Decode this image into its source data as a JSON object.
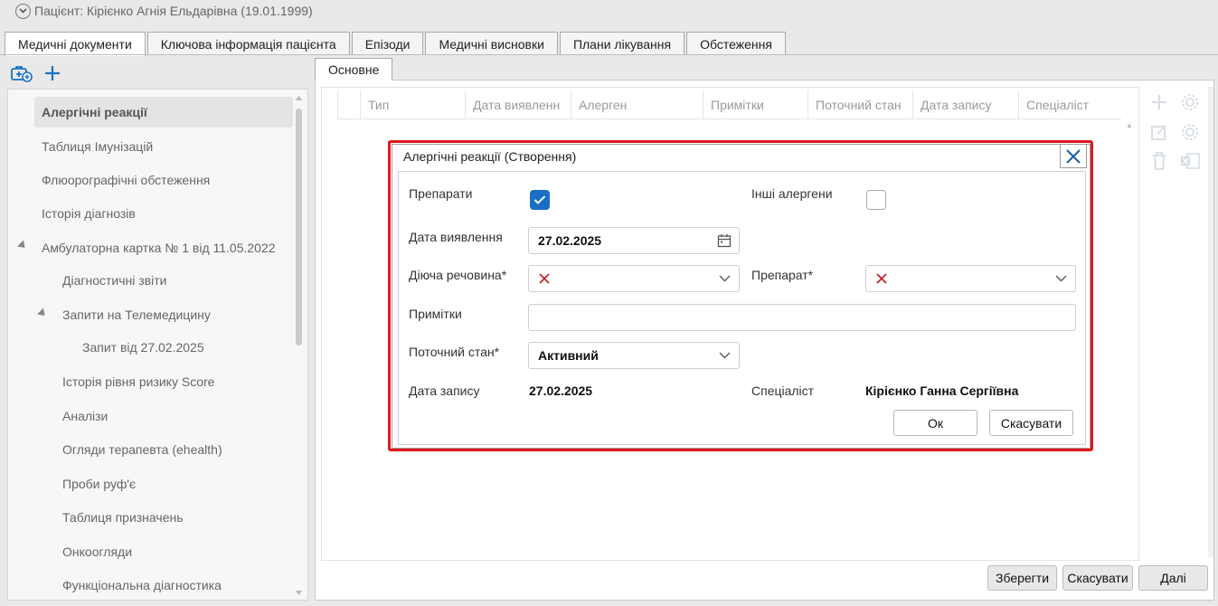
{
  "patient": {
    "label": "Пацієнт: Кірієнко Агнія Ельдарівна (19.01.1999)"
  },
  "top_tabs": [
    {
      "label": "Медичні документи",
      "active": true
    },
    {
      "label": "Ключова інформація пацієнта",
      "active": false
    },
    {
      "label": "Епізоди",
      "active": false
    },
    {
      "label": "Медичні висновки",
      "active": false
    },
    {
      "label": "Плани лікування",
      "active": false
    },
    {
      "label": "Обстеження",
      "active": false
    }
  ],
  "tree": {
    "items": [
      {
        "label": "Алергічні реакції"
      },
      {
        "label": "Таблиця Імунізацій"
      },
      {
        "label": "Флюорографічні обстеження"
      },
      {
        "label": "Історія діагнозів"
      },
      {
        "label": "Амбулаторна картка № 1 від 11.05.2022"
      },
      {
        "label": "Діагностичні звіти"
      },
      {
        "label": "Запити на Телемедицину"
      },
      {
        "label": "Запит від 27.02.2025"
      },
      {
        "label": "Історія рівня ризику Score"
      },
      {
        "label": "Аналізи"
      },
      {
        "label": "Огляди терапевта (ehealth)"
      },
      {
        "label": "Проби руф'є"
      },
      {
        "label": "Таблиця призначень"
      },
      {
        "label": "Онкоогляди"
      },
      {
        "label": "Функціональна діагностика"
      }
    ]
  },
  "sub_tab": {
    "label": "Основне"
  },
  "grid": {
    "columns": [
      "Тип",
      "Дата виявленн",
      "Алерген",
      "Примітки",
      "Поточний стан",
      "Дата запису",
      "Спеціаліст"
    ]
  },
  "dialog": {
    "title": "Алергічні реакції (Створення)",
    "drugs_label": "Препарати",
    "drugs_checked": true,
    "other_allergens_label": "Інші алергени",
    "other_allergens_checked": false,
    "detection_date_label": "Дата виявлення",
    "detection_date_value": "27.02.2025",
    "active_substance_label": "Діюча речовина*",
    "drug_label": "Препарат*",
    "notes_label": "Примітки",
    "notes_value": "",
    "current_state_label": "Поточний стан*",
    "current_state_value": "Активний",
    "record_date_label": "Дата запису",
    "record_date_value": "27.02.2025",
    "specialist_label": "Спеціаліст",
    "specialist_value": "Кірієнко Ганна Сергіївна",
    "ok_label": "Ок",
    "cancel_label": "Скасувати"
  },
  "footer": {
    "save_label": "Зберегти",
    "cancel_label": "Скасувати",
    "next_label": "Далі"
  },
  "colors": {
    "accent_blue": "#1a6fc4",
    "highlight_red": "#e0161b",
    "error_x_red": "#c0262d"
  }
}
